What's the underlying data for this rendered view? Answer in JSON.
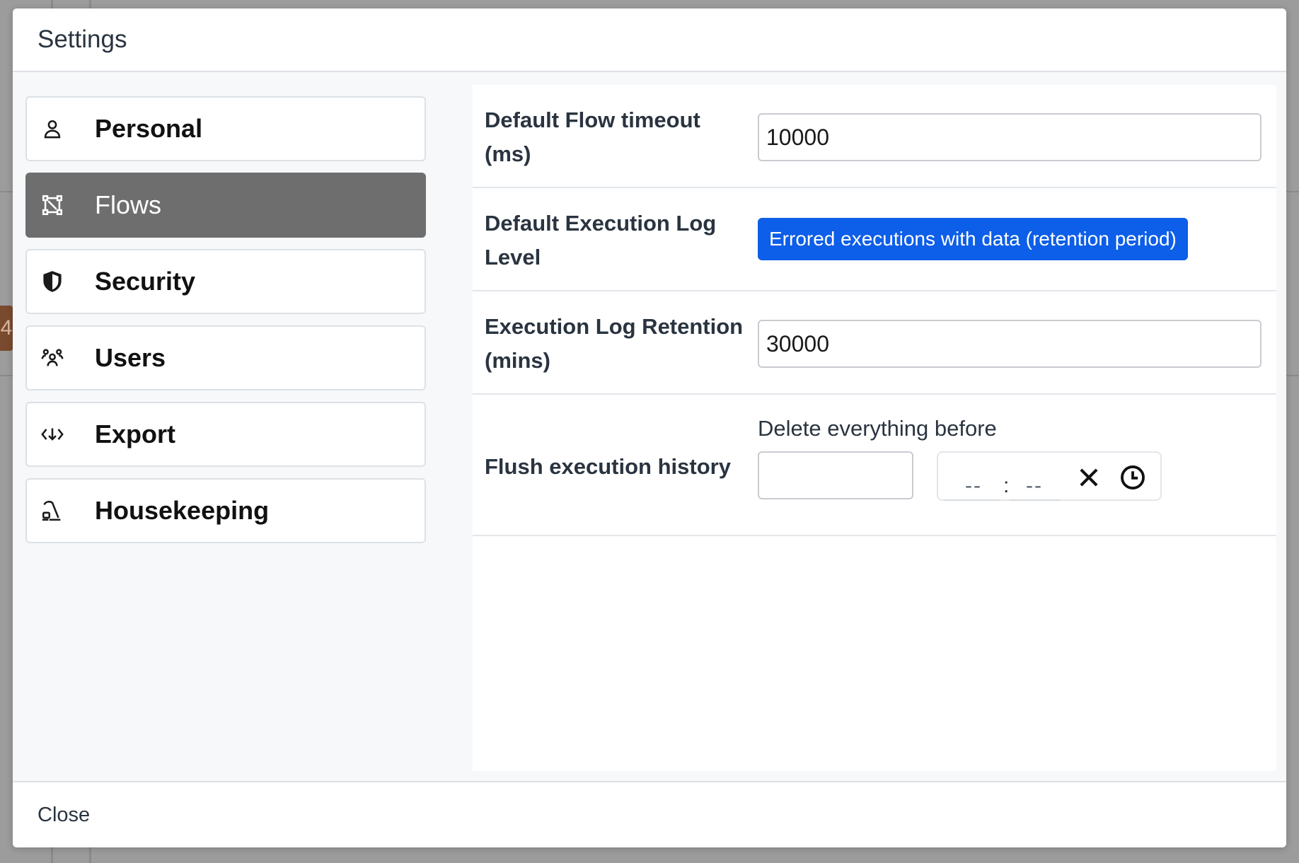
{
  "modal": {
    "title": "Settings",
    "close_label": "Close"
  },
  "sidebar": {
    "items": [
      {
        "label": "Personal",
        "icon": "person-icon",
        "active": false
      },
      {
        "label": "Flows",
        "icon": "flows-icon",
        "active": true
      },
      {
        "label": "Security",
        "icon": "shield-icon",
        "active": false
      },
      {
        "label": "Users",
        "icon": "users-icon",
        "active": false
      },
      {
        "label": "Export",
        "icon": "export-icon",
        "active": false
      },
      {
        "label": "Housekeeping",
        "icon": "vacuum-icon",
        "active": false
      }
    ]
  },
  "settings": {
    "flow_timeout": {
      "label": "Default Flow timeout (ms)",
      "value": "10000"
    },
    "log_level": {
      "label": "Default Execution Log Level",
      "value": "Errored executions with data (retention period)"
    },
    "log_retention": {
      "label": "Execution Log Retention (mins)",
      "value": "30000"
    },
    "flush_history": {
      "label": "Flush execution history",
      "caption": "Delete everything before",
      "date_value": "",
      "hours_placeholder": "--",
      "separator": ":",
      "minutes_placeholder": "--"
    }
  },
  "colors": {
    "accent": "#0d5ee8",
    "active_nav": "#6e6e6e"
  }
}
